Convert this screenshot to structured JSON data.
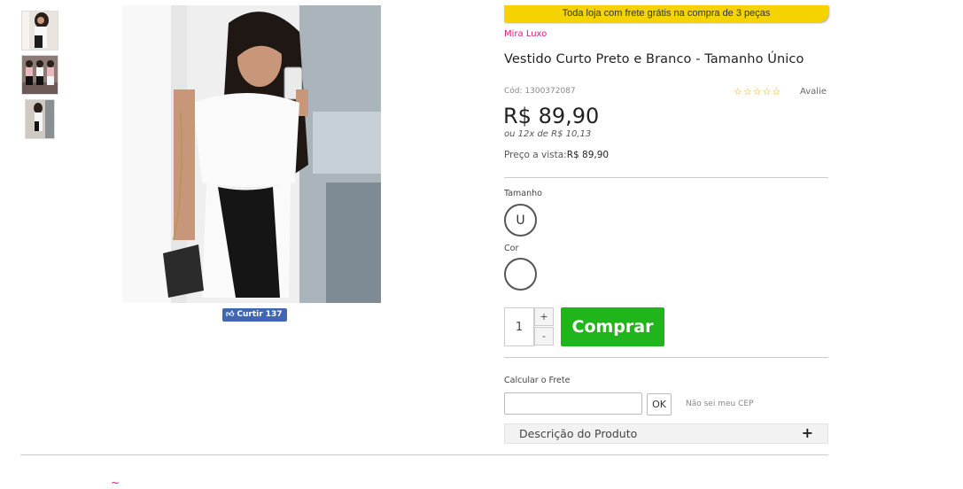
{
  "gallery": {
    "thumbnails": [
      "product-thumbnail-1",
      "product-thumbnail-2",
      "product-thumbnail-3"
    ],
    "main_image": "product-main-image",
    "fb_like": {
      "label": "Curtir",
      "count": "137"
    }
  },
  "product": {
    "banner": "Toda loja com frete grátis na compra de 3 peças",
    "brand": "Mira Luxo",
    "title": "Vestido Curto Preto e Branco - Tamanho Único",
    "sku": "Cód: 1300372087",
    "rating_stars": "☆☆☆☆☆",
    "review_link": "Avalie",
    "price": "R$ 89,90",
    "installment": "ou 12x de R$ 10,13",
    "cash_label": "Preço a vista:",
    "cash_price": "R$ 89,90"
  },
  "options": {
    "size_label": "Tamanho",
    "size_value": "U",
    "color_label": "Cor"
  },
  "purchase": {
    "quantity": "1",
    "plus": "+",
    "minus": "-",
    "buy_label": "Comprar"
  },
  "shipping": {
    "label": "Calcular o Frete",
    "input_value": "",
    "ok_label": "OK",
    "no_cep_link": "Não sei meu CEP"
  },
  "description": {
    "label": "Descrição do Produto",
    "toggle": "+"
  },
  "footer": {
    "fragment": "~"
  },
  "colors": {
    "brand_pink": "#e0197d",
    "buy_green": "#21b51c",
    "banner_yellow": "#f5d300",
    "fb_blue": "#4267b2"
  }
}
